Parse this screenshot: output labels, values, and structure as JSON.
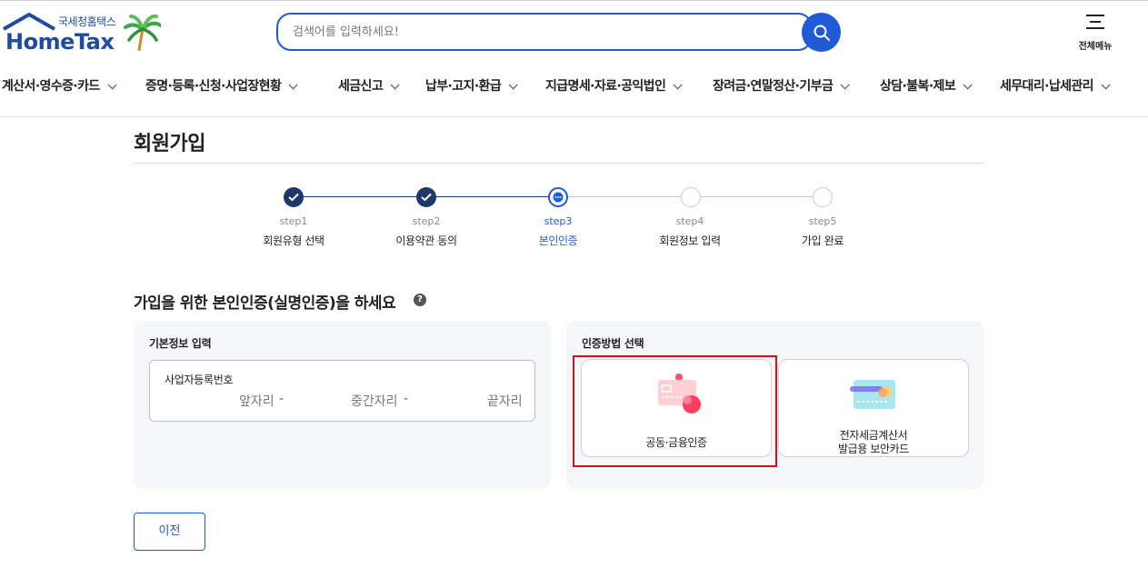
{
  "header": {
    "logo_sub": "국세청홈택스",
    "logo_main": "HomeTax",
    "search_placeholder": "검색어를 입력하세요!",
    "all_menu_label": "전체메뉴"
  },
  "nav": {
    "items": [
      {
        "label": "계산서·영수증·카드"
      },
      {
        "label": "증명·등록·신청·사업장현황"
      },
      {
        "label": "세금신고"
      },
      {
        "label": "납부·고지·환급"
      },
      {
        "label": "지급명세·자료·공익법인"
      },
      {
        "label": "장려금·연말정산·기부금"
      },
      {
        "label": "상담·불복·제보"
      },
      {
        "label": "세무대리·납세관리"
      }
    ]
  },
  "page": {
    "title": "회원가입",
    "section_title": "가입을 위한 본인인증(실명인증)을 하세요",
    "help_icon": "?"
  },
  "steps": [
    {
      "num": "step1",
      "name": "회원유형 선택",
      "state": "done"
    },
    {
      "num": "step2",
      "name": "이용약관 동의",
      "state": "done"
    },
    {
      "num": "step3",
      "name": "본인인증",
      "state": "current"
    },
    {
      "num": "step4",
      "name": "회원정보 입력",
      "state": "todo"
    },
    {
      "num": "step5",
      "name": "가입 완료",
      "state": "todo"
    }
  ],
  "basic_info": {
    "title": "기본정보 입력",
    "field_label": "사업자등록번호",
    "front": "앞자리",
    "middle": "중간자리",
    "end": "끝자리",
    "sep": "-"
  },
  "auth_method": {
    "title": "인증방법 선택",
    "option1": "공동·금융인증",
    "option2_line1": "전자세금계산서",
    "option2_line2": "발급용 보안카드"
  },
  "footer": {
    "prev_label": "이전"
  },
  "colors": {
    "brand_blue": "#1f5bd6",
    "step_done": "#1b3a6b",
    "highlight_red": "#d0121b"
  }
}
